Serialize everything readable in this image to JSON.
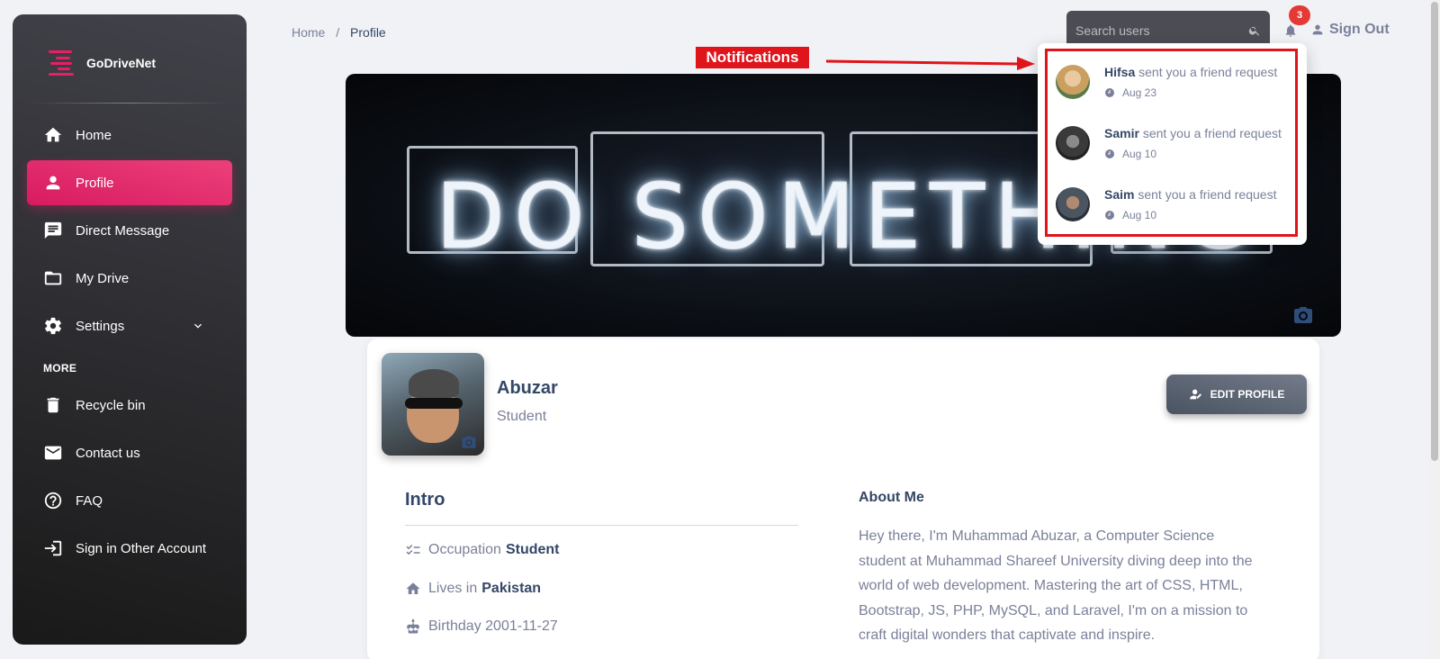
{
  "brand": {
    "name": "GoDriveNet",
    "accent": "#e91e63"
  },
  "sidebar": {
    "items": [
      {
        "label": "Home",
        "icon": "home-icon"
      },
      {
        "label": "Profile",
        "icon": "person-icon",
        "active": true
      },
      {
        "label": "Direct Message",
        "icon": "chat-icon"
      },
      {
        "label": "My Drive",
        "icon": "folder-icon"
      },
      {
        "label": "Settings",
        "icon": "gear-icon"
      }
    ],
    "more_label": "MORE",
    "more_items": [
      {
        "label": "Recycle bin",
        "icon": "trash-icon"
      },
      {
        "label": "Contact us",
        "icon": "mail-icon"
      },
      {
        "label": "FAQ",
        "icon": "help-icon"
      },
      {
        "label": "Sign in Other Account",
        "icon": "login-icon"
      }
    ]
  },
  "breadcrumb": {
    "root": "Home",
    "separator": "/",
    "current": "Profile"
  },
  "header": {
    "search_placeholder": "Search users",
    "notification_count": "3",
    "sign_out_label": "Sign Out"
  },
  "annotation": {
    "label": "Notifications",
    "color": "#e0141b"
  },
  "notifications": [
    {
      "name": "Hifsa",
      "text": "sent you a friend request",
      "time": "Aug 23"
    },
    {
      "name": "Samir",
      "text": "sent you a friend request",
      "time": "Aug 10"
    },
    {
      "name": "Saim",
      "text": "sent you a friend request",
      "time": "Aug 10"
    }
  ],
  "cover": {
    "neon_text": "DO SOMETHING"
  },
  "profile": {
    "name": "Abuzar",
    "role": "Student",
    "edit_label": "EDIT PROFILE",
    "intro_title": "Intro",
    "occupation_label": "Occupation",
    "occupation_value": "Student",
    "lives_label": "Lives in",
    "lives_value": "Pakistan",
    "birthday_label": "Birthday 2001-11-27",
    "about_title": "About Me",
    "about_text": "Hey there, I'm Muhammad Abuzar, a Computer Science student at Muhammad Shareef University diving deep into the world of web development. Mastering the art of CSS, HTML, Bootstrap, JS, PHP, MySQL, and Laravel, I'm on a mission to craft digital wonders that captivate and inspire."
  }
}
